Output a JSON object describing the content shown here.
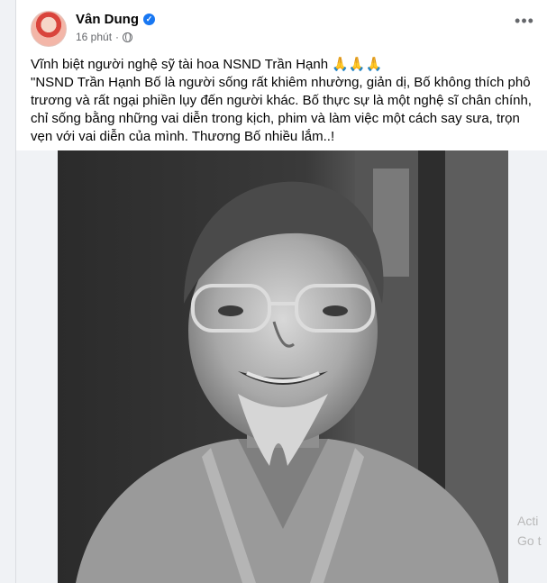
{
  "post": {
    "author": "Vân Dung",
    "time": "16 phút",
    "separator": "·",
    "line1": "Vĩnh biệt người nghệ sỹ tài hoa NSND Trần Hạnh",
    "line1_emoji": "🙏🙏🙏",
    "body": "\"NSND Trần Hạnh Bố là người sống rất khiêm nhường, giản dị, Bố không thích phô trương và rất ngại phiền lụy đến người khác. Bố thực sự là một nghệ sĩ chân chính, chỉ sống bằng những vai diễn trong kịch, phim và làm việc một cách say sưa, trọn vẹn với vai diễn của mình. Thương Bố nhiều lắm..!"
  },
  "icons": {
    "verified": "verified-badge-icon",
    "globe": "globe-icon",
    "more": "more-options-icon"
  },
  "watermark": {
    "line1": "Acti",
    "line2": "Go t"
  },
  "colors": {
    "accent": "#1877f2",
    "text": "#050505",
    "secondary": "#65676b"
  }
}
